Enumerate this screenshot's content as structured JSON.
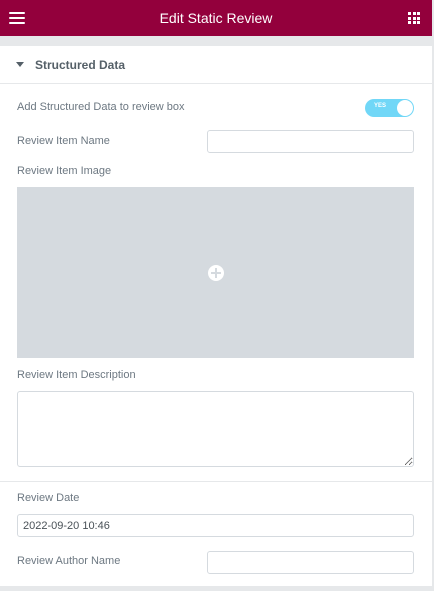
{
  "header": {
    "title": "Edit Static Review",
    "menu_icon": "hamburger-menu-icon",
    "widgets_icon": "grid-icon"
  },
  "section": {
    "title": "Structured Data",
    "expanded": true
  },
  "fields": {
    "structured_data": {
      "label": "Add Structured Data to review box",
      "toggle_text": "YES",
      "enabled": true
    },
    "item_name": {
      "label": "Review Item Name",
      "value": ""
    },
    "item_image": {
      "label": "Review Item Image",
      "icon": "add-image-icon"
    },
    "item_description": {
      "label": "Review Item Description",
      "value": ""
    },
    "review_date": {
      "label": "Review Date",
      "value": "2022-09-20 10:46"
    },
    "author_name": {
      "label": "Review Author Name",
      "value": ""
    }
  },
  "colors": {
    "header_bg": "#93003c",
    "toggle_on": "#71d7f7",
    "panel_bg": "#ffffff",
    "image_placeholder": "#d5dadf"
  }
}
